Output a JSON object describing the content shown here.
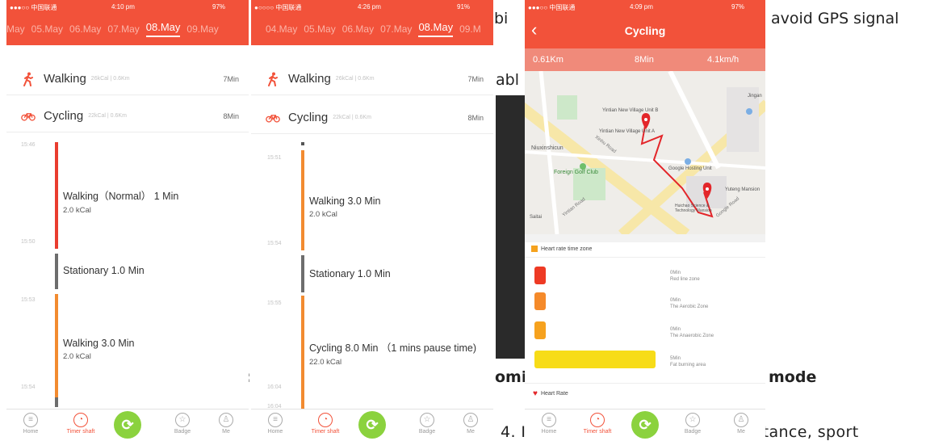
{
  "document": {
    "frag1": "bi",
    "frag2": "avoid GPS signal",
    "frag3": "abl",
    "frag4": ":",
    "frag5": "omi",
    "frag6": "mode",
    "frag7": "4. It shows time, sport mode, distance, sport"
  },
  "phone1": {
    "status": {
      "carrier": "●●●○○ 中国联通",
      "time": "4:10 pm",
      "battery": "97%"
    },
    "dates": [
      "May",
      "05.May",
      "06.May",
      "07.May",
      "08.May",
      "09.May"
    ],
    "selected_date": "08.May",
    "walking": {
      "name": "Walking",
      "sub": "26kCal | 0.6Km",
      "dur": "7Min"
    },
    "cycling": {
      "name": "Cycling",
      "sub": "22kCal | 0.6Km",
      "dur": "8Min"
    },
    "times": [
      "15:46",
      "15:50",
      "15:53",
      "15:54"
    ],
    "seg1": {
      "label": "Walking（Normal） 1 Min",
      "kcal": "2.0 kCal"
    },
    "seg2": {
      "label": "Stationary 1.0 Min"
    },
    "seg3": {
      "label": "Walking 3.0 Min",
      "kcal": "2.0 kCal"
    },
    "tabs": {
      "home": "Home",
      "timer": "Timer shaft",
      "badge": "Badge",
      "me": "Me"
    }
  },
  "phone2": {
    "status": {
      "carrier": "●○○○○ 中国联通",
      "time": "4:26 pm",
      "battery": "91%"
    },
    "dates": [
      "04.May",
      "05.May",
      "06.May",
      "07.May",
      "08.May",
      "09.M"
    ],
    "selected_date": "08.May",
    "walking": {
      "name": "Walking",
      "sub": "26kCal | 0.6Km",
      "dur": "7Min"
    },
    "cycling": {
      "name": "Cycling",
      "sub": "22kCal | 0.6Km",
      "dur": "8Min"
    },
    "times": [
      "15:51",
      "15:54",
      "15:55",
      "16:04",
      "16:04"
    ],
    "seg1": {
      "label": "Walking 3.0 Min",
      "kcal": "2.0 kCal"
    },
    "seg2": {
      "label": "Stationary 1.0 Min"
    },
    "seg3": {
      "label": "Cycling 8.0 Min （1 mins pause time)",
      "kcal": "22.0 kCal"
    },
    "tabs": {
      "home": "Home",
      "timer": "Timer shaft",
      "badge": "Badge",
      "me": "Me"
    }
  },
  "phone3": {
    "status": {
      "carrier": "●●●○○ 中国联通",
      "time": "4:09 pm",
      "battery": "97%"
    },
    "title": "Cycling",
    "stats": {
      "distance": "0.61Km",
      "time": "8Min",
      "speed": "4.1km/h"
    },
    "map_labels": [
      "Yintian New Village Unit B",
      "Yintian New Village Unit A",
      "Niuxinshicun",
      "Xinhu Road",
      "Foreign Golf Club",
      "Google Hosting Unit",
      "Yuteng Mansion",
      "Yintian Road",
      "Saitai",
      "Huichao Science & Technology Mansion",
      "Gongle Road",
      "Jingan"
    ],
    "hr_title": "Heart rate time zone",
    "zones": [
      {
        "time": "0Min",
        "name": "Red line zone",
        "color": "#ee3a24",
        "fill": 0.04
      },
      {
        "time": "0Min",
        "name": "The Aerobic Zone",
        "color": "#f58a2a",
        "fill": 0.04
      },
      {
        "time": "0Min",
        "name": "The Anaerobic Zone",
        "color": "#f6a21e",
        "fill": 0.04
      },
      {
        "time": "5Min",
        "name": "Fat burning area",
        "color": "#f7dc18",
        "fill": 0.5
      }
    ],
    "hr_rate": "Heart Rate",
    "tabs": {
      "home": "Home",
      "timer": "Timer shaft",
      "badge": "Badge",
      "me": "Me"
    }
  },
  "colors": {
    "brand": "#f2523a",
    "walk": "#f28b30",
    "red": "#e93d2f",
    "gray": "#6d6d6d",
    "green": "#8bd23e"
  }
}
